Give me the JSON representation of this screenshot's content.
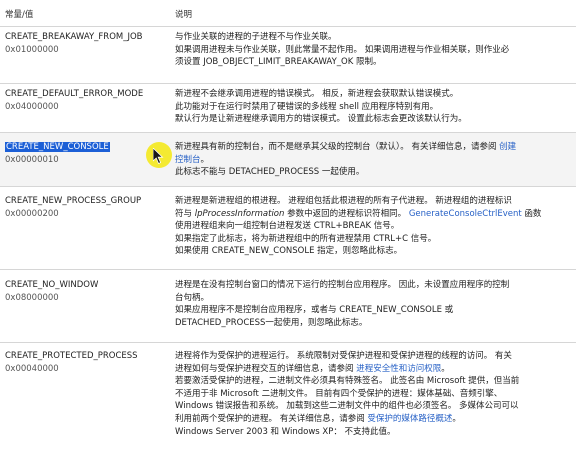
{
  "header": {
    "col_value": "常量/值",
    "col_desc": "说明"
  },
  "rows": [
    {
      "name": "CREATE_BREAKAWAY_FROM_JOB",
      "value": "0x01000000",
      "lines": [
        "与作业关联的进程的子进程不与作业关联。",
        "如果调用进程未与作业关联，则此常量不起作用。 如果调用进程与作业相关联，则作业必",
        "须设置 JOB_OBJECT_LIMIT_BREAKAWAY_OK 限制。"
      ]
    },
    {
      "name": "CREATE_DEFAULT_ERROR_MODE",
      "value": "0x04000000",
      "lines": [
        "新进程不会继承调用进程的错误模式。 相反，新进程会获取默认错误模式。",
        "此功能对于在运行时禁用了硬错误的多线程 shell 应用程序特别有用。",
        "默认行为是让新进程继承调用方的错误模式。 设置此标志会更改该默认行为。"
      ]
    },
    {
      "name": "CREATE_NEW_CONSOLE",
      "value": "0x00000010",
      "line1_pre": "新进程具有新的控制台，而不是继承其父级的控制台（默认）。 有关详细信息，请参阅 ",
      "line1_link": "创建",
      "line2_link": "控制台",
      "line2_post": "。",
      "line3": "此标志不能与 DETACHED_PROCESS 一起使用。"
    },
    {
      "name": "CREATE_NEW_PROCESS_GROUP",
      "value": "0x00000200",
      "l1": "新进程是新进程组的根进程。 进程组包括此根进程的所有子代进程。 新进程组的进程标识",
      "l2_pre": "符与 ",
      "l2_em": "lpProcessInformation",
      "l2_mid": " 参数中返回的进程标识符相同。 ",
      "l2_link": "GenerateConsoleCtrlEvent",
      "l2_post": " 函数",
      "l3": "使用进程组来向一组控制台进程发送 CTRL+BREAK 信号。",
      "l4": "如果指定了此标志，将为新进程组中的所有进程禁用 CTRL+C 信号。",
      "l5": "如果使用 CREATE_NEW_CONSOLE 指定，则忽略此标志。"
    },
    {
      "name": "CREATE_NO_WINDOW",
      "value": "0x08000000",
      "lines": [
        "进程是在没有控制台窗口的情况下运行的控制台应用程序。 因此，未设置应用程序的控制",
        "台句柄。",
        "如果应用程序不是控制台应用程序，或者与 CREATE_NEW_CONSOLE 或",
        "DETACHED_PROCESS一起使用，则忽略此标志。"
      ]
    },
    {
      "name": "CREATE_PROTECTED_PROCESS",
      "value": "0x00040000",
      "p1": "进程将作为受保护的进程运行。 系统限制对受保护进程和受保护进程的线程的访问。 有关",
      "p2_pre": "进程如何与受保护进程交互的详细信息，请参阅 ",
      "p2_link": "进程安全性和访问权限",
      "p2_post": "。",
      "p3": "若要激活受保护的进程，二进制文件必须具有特殊签名。 此签名由 Microsoft 提供，但当前",
      "p4": "不适用于非 Microsoft 二进制文件。 目前有四个受保护的进程：媒体基础、音频引擎、",
      "p5": "Windows 错误报告和系统。 加载到这些二进制文件中的组件也必须签名。 多媒体公司可以",
      "p6_pre": "利用前两个受保护的进程。 有关详细信息，请参阅 ",
      "p6_link": "受保护的媒体路径概述",
      "p6_post": "。",
      "p7": "Windows Server 2003 和 Windows XP： 不支持此值。"
    }
  ]
}
